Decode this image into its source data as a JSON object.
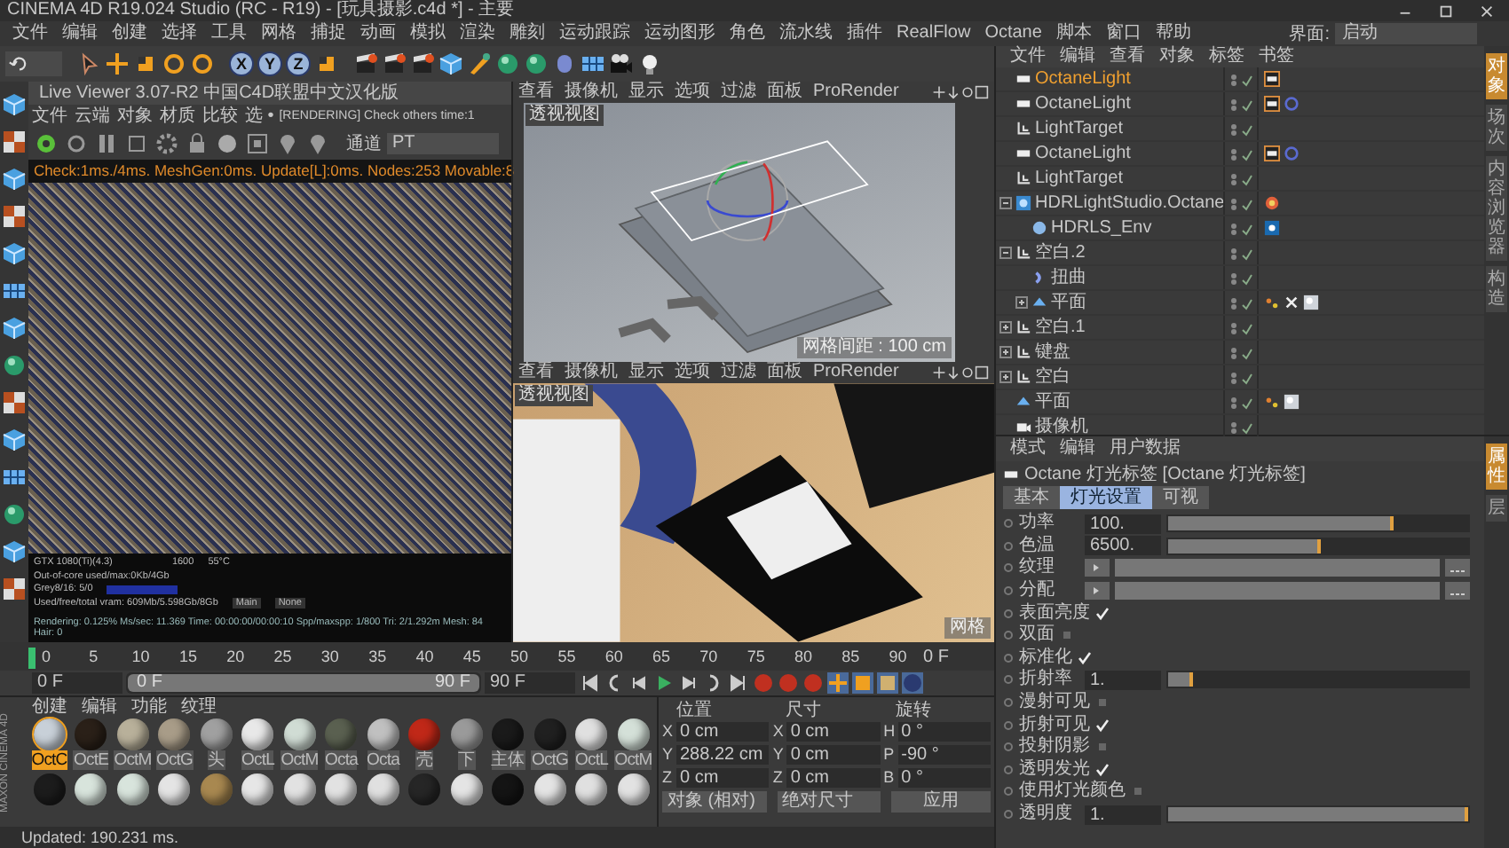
{
  "window": {
    "title": "CINEMA 4D R19.024 Studio (RC - R19) - [玩具摄影.c4d *] - 主要"
  },
  "menu": [
    "文件",
    "编辑",
    "创建",
    "选择",
    "工具",
    "网格",
    "捕捉",
    "动画",
    "模拟",
    "渲染",
    "雕刻",
    "运动跟踪",
    "运动图形",
    "角色",
    "流水线",
    "插件",
    "RealFlow",
    "Octane",
    "脚本",
    "窗口",
    "帮助"
  ],
  "layout_selector": {
    "label": "界面:",
    "value": "启动"
  },
  "axis_buttons": [
    {
      "label": "X",
      "on": true
    },
    {
      "label": "Y",
      "on": true
    },
    {
      "label": "Z",
      "on": true
    }
  ],
  "live_viewer": {
    "title": "Live Viewer 3.07-R2 中国C4D联盟中文汉化版",
    "menu": [
      "文件",
      "云端",
      "对象",
      "材质",
      "比较",
      "选 •"
    ],
    "status_text": "[RENDERING] Check others time:1",
    "channel_label": "通道",
    "channel_value": "PT",
    "info": "Check:1ms./4ms. MeshGen:0ms. Update[L]:0ms. Nodes:253 Movable:8",
    "stats": {
      "gpu": "GTX 1080(Ti)(4.3)",
      "clock": "1600",
      "temp": "55°C",
      "out_of_core": "Out-of-core used/max:0Kb/4Gb",
      "grey": "Grey8/16: 5/0",
      "vram": "Used/free/total vram: 609Mb/5.598Gb/8Gb",
      "buttons": [
        "Main",
        "None"
      ],
      "summary": "Rendering: 0.125%  Ms/sec: 11.369  Time: 00:00:00/00:00:10  Spp/maxspp: 1/800  Tri: 2/1.292m  Mesh: 84  Hair: 0"
    }
  },
  "viewports": [
    {
      "menu": [
        "查看",
        "摄像机",
        "显示",
        "选项",
        "过滤",
        "面板",
        "ProRender"
      ],
      "camera": "透视视图",
      "grid_spacing": "网格间距 : 100 cm",
      "kind": "shaded"
    },
    {
      "menu": [
        "查看",
        "摄像机",
        "显示",
        "选项",
        "过滤",
        "面板",
        "ProRender"
      ],
      "camera": "透视视图",
      "grid_spacing": "网格",
      "kind": "textured"
    }
  ],
  "timeline": {
    "ticks": [
      "0",
      "5",
      "10",
      "15",
      "20",
      "25",
      "30",
      "35",
      "40",
      "45",
      "50",
      "55",
      "60",
      "65",
      "70",
      "75",
      "80",
      "85",
      "90"
    ],
    "current": "0 F"
  },
  "transport": {
    "start": "0 F",
    "range_start": "0 F",
    "range_end": "90 F",
    "end": "90 F",
    "range": {
      "level": 1
    }
  },
  "materials": {
    "menu": [
      "创建",
      "编辑",
      "功能",
      "纹理"
    ],
    "items": [
      {
        "label": "OctC",
        "color": "#c8d0d8",
        "selected": true
      },
      {
        "label": "OctE",
        "color": "#2a2018",
        "selected": false
      },
      {
        "label": "OctM",
        "color": "#b8b09a",
        "selected": false
      },
      {
        "label": "OctG",
        "color": "#a89c88",
        "selected": false
      },
      {
        "label": "头",
        "color": "#a0a0a0",
        "selected": false
      },
      {
        "label": "OctL",
        "color": "#e8e8e8",
        "selected": false
      },
      {
        "label": "OctM",
        "color": "#d0dcd4",
        "selected": false
      },
      {
        "label": "Octa",
        "color": "#5a6050",
        "selected": false
      },
      {
        "label": "Octa",
        "color": "#c0c0c0",
        "selected": false
      },
      {
        "label": "壳",
        "color": "#c02818",
        "selected": false
      },
      {
        "label": "下",
        "color": "#9a9a9a",
        "selected": false
      },
      {
        "label": "主体",
        "color": "#1a1a1a",
        "selected": false
      },
      {
        "label": "OctG",
        "color": "#202020",
        "selected": false
      },
      {
        "label": "OctL",
        "color": "#e0e0e0",
        "selected": false
      },
      {
        "label": "OctM",
        "color": "#d4e0d8",
        "selected": false
      },
      {
        "color": "#1c1c1c",
        "selected": false
      },
      {
        "color": "#d8e4dc",
        "selected": false
      },
      {
        "color": "#d8e4dc",
        "selected": false
      },
      {
        "color": "#e4e4e4",
        "selected": false
      },
      {
        "color": "#a88850",
        "selected": false
      },
      {
        "color": "#e6e6e6",
        "selected": false
      },
      {
        "color": "#e2e2e2",
        "selected": false
      },
      {
        "color": "#e2e2e2",
        "selected": false
      },
      {
        "color": "#e0e0e0",
        "selected": false
      },
      {
        "color": "#262626",
        "selected": false
      },
      {
        "color": "#e4e4e4",
        "selected": false
      },
      {
        "color": "#141414",
        "selected": false
      },
      {
        "color": "#e4e4e4",
        "selected": false
      },
      {
        "color": "#e0e0e0",
        "selected": false
      },
      {
        "color": "#e2e2e2",
        "selected": false
      }
    ]
  },
  "maxon_logo": "MAXON CINEMA 4D",
  "coordinates": {
    "headers": [
      "位置",
      "尺寸",
      "旋转"
    ],
    "rows": [
      {
        "cells": [
          {
            "axis": "X",
            "value": "0 cm"
          },
          {
            "axis": "X",
            "value": "0 cm"
          },
          {
            "axis": "H",
            "value": "0 °"
          }
        ]
      },
      {
        "cells": [
          {
            "axis": "Y",
            "value": "288.22 cm"
          },
          {
            "axis": "Y",
            "value": "0 cm"
          },
          {
            "axis": "P",
            "value": "-90 °"
          }
        ]
      },
      {
        "cells": [
          {
            "axis": "Z",
            "value": "0 cm"
          },
          {
            "axis": "Z",
            "value": "0 cm"
          },
          {
            "axis": "B",
            "value": "0 °"
          }
        ]
      }
    ],
    "dropdowns": [
      "对象 (相对)",
      "绝对尺寸"
    ],
    "apply_button": "应用"
  },
  "status_bar": "Updated: 190.231 ms.",
  "object_manager": {
    "menu": [
      "文件",
      "编辑",
      "查看",
      "对象",
      "标签",
      "书签"
    ],
    "objects": [
      {
        "name": "OctaneLight",
        "kind": "light",
        "selected": true,
        "tags": [
          {
            "kind": "light"
          }
        ]
      },
      {
        "name": "OctaneLight",
        "kind": "light",
        "selected": false,
        "tags": [
          {
            "kind": "light"
          },
          {
            "kind": "target"
          }
        ]
      },
      {
        "name": "LightTarget",
        "kind": "null",
        "selected": false
      },
      {
        "name": "OctaneLight",
        "kind": "light",
        "selected": false,
        "tags": [
          {
            "kind": "light"
          },
          {
            "kind": "target"
          }
        ]
      },
      {
        "name": "LightTarget",
        "kind": "null",
        "selected": false
      },
      {
        "name": "HDRLightStudio.Octane",
        "kind": "hdr",
        "selected": false,
        "expanded": true,
        "tags": [
          {
            "kind": "hdr"
          }
        ],
        "children": [
          {
            "name": "HDRLS_Env",
            "kind": "sphere",
            "selected": false,
            "tags": [
              {
                "kind": "env"
              }
            ]
          }
        ]
      },
      {
        "name": "空白.2",
        "kind": "null",
        "selected": false,
        "expanded": true,
        "children": [
          {
            "name": "扭曲",
            "kind": "deformer",
            "selected": false
          },
          {
            "name": "平面",
            "kind": "plane",
            "selected": false,
            "expanded": false,
            "tags": [
              {
                "kind": "texture"
              },
              {
                "kind": "phong"
              },
              {
                "kind": "material"
              }
            ]
          }
        ]
      },
      {
        "name": "空白.1",
        "kind": "null",
        "selected": false,
        "expanded": false
      },
      {
        "name": "键盘",
        "kind": "null",
        "selected": false,
        "expanded": false
      },
      {
        "name": "空白",
        "kind": "null",
        "selected": false,
        "expanded": false
      },
      {
        "name": "平面",
        "kind": "plane",
        "selected": false,
        "tags": [
          {
            "kind": "texture"
          },
          {
            "kind": "material"
          }
        ]
      },
      {
        "name": "摄像机",
        "kind": "camera",
        "selected": false
      }
    ]
  },
  "side_tabs": [
    {
      "label": "对象",
      "selected": true
    },
    {
      "label": "场次",
      "selected": false
    },
    {
      "label": "内容浏览器",
      "selected": false
    },
    {
      "label": "构造",
      "selected": false
    }
  ],
  "attributes": {
    "menu": [
      "模式",
      "编辑",
      "用户数据"
    ],
    "title": "Octane 灯光标签 [Octane 灯光标签]",
    "tabs": [
      {
        "label": "基本",
        "selected": false
      },
      {
        "label": "灯光设置",
        "selected": true
      },
      {
        "label": "可视",
        "selected": false
      }
    ],
    "params": [
      {
        "kind": "slider",
        "label": "功率",
        "value": "100.",
        "level": 0.75
      },
      {
        "kind": "slider",
        "label": "色温",
        "value": "6500.",
        "level": 0.51
      },
      {
        "kind": "link",
        "label": "纹理"
      },
      {
        "kind": "link",
        "label": "分配"
      },
      {
        "kind": "checkbox",
        "label": "表面亮度",
        "checked": true
      },
      {
        "kind": "checkbox",
        "label": "双面",
        "checked": false
      },
      {
        "kind": "checkbox",
        "label": "标准化",
        "checked": true
      },
      {
        "kind": "slider",
        "label": "折射率",
        "value": "1.",
        "level": 0.08
      },
      {
        "kind": "checkbox",
        "label": "漫射可见",
        "checked": false
      },
      {
        "kind": "checkbox",
        "label": "折射可见",
        "checked": true
      },
      {
        "kind": "checkbox",
        "label": "投射阴影",
        "checked": false
      },
      {
        "kind": "checkbox",
        "label": "透明发光",
        "checked": true
      },
      {
        "kind": "checkbox",
        "label": "使用灯光颜色",
        "checked": false
      },
      {
        "kind": "slider",
        "label": "透明度",
        "value": "1.",
        "level": 1
      }
    ]
  },
  "attribute_side_tabs": [
    {
      "label": "属性",
      "selected": true
    },
    {
      "label": "层",
      "selected": false
    }
  ]
}
